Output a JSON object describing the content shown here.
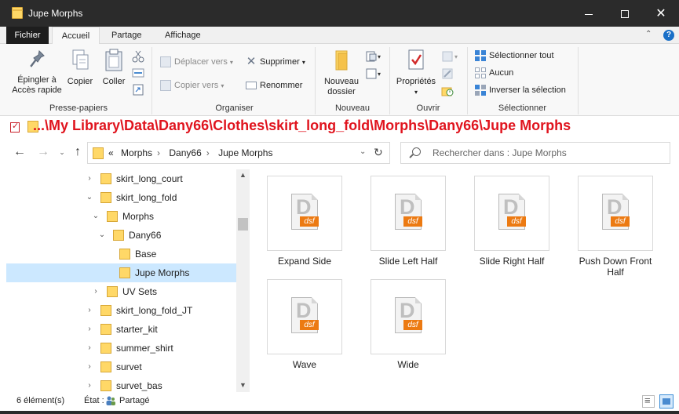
{
  "window": {
    "title": "Jupe Morphs",
    "controls": {
      "minimize": "minimize",
      "maximize": "maximize",
      "close": "close"
    }
  },
  "ribbon": {
    "tabs": {
      "file": "Fichier",
      "home": "Accueil",
      "share": "Partage",
      "view": "Affichage"
    },
    "clipboard": {
      "pin_line1": "Épingler à",
      "pin_line2": "Accès rapide",
      "copy": "Copier",
      "paste": "Coller",
      "label": "Presse-papiers"
    },
    "organize": {
      "move_to": "Déplacer vers",
      "copy_to": "Copier vers",
      "delete": "Supprimer",
      "rename": "Renommer",
      "label": "Organiser"
    },
    "new": {
      "new_folder_line1": "Nouveau",
      "new_folder_line2": "dossier",
      "label": "Nouveau"
    },
    "open": {
      "properties": "Propriétés",
      "label": "Ouvrir"
    },
    "select": {
      "select_all": "Sélectionner tout",
      "select_none": "Aucun",
      "invert": "Inverser la sélection",
      "label": "Sélectionner"
    }
  },
  "overlay_path": "...\\My Library\\Data\\Dany66\\Clothes\\skirt_long_fold\\Morphs\\Dany66\\Jupe Morphs",
  "address": {
    "overflow": "«",
    "crumbs": [
      "Morphs",
      "Dany66",
      "Jupe Morphs"
    ]
  },
  "search": {
    "placeholder": "Rechercher dans : Jupe Morphs"
  },
  "nav_tree": [
    {
      "label": "skirt_long_court",
      "expander": "›",
      "depth": 0,
      "selected": false
    },
    {
      "label": "skirt_long_fold",
      "expander": "⌄",
      "depth": 0,
      "selected": false
    },
    {
      "label": "Morphs",
      "expander": "⌄",
      "depth": 1,
      "selected": false
    },
    {
      "label": "Dany66",
      "expander": "⌄",
      "depth": 2,
      "selected": false
    },
    {
      "label": "Base",
      "expander": "",
      "depth": 3,
      "selected": false
    },
    {
      "label": "Jupe Morphs",
      "expander": "",
      "depth": 3,
      "selected": true
    },
    {
      "label": "UV Sets",
      "expander": "›",
      "depth": 1,
      "selected": false
    },
    {
      "label": "skirt_long_fold_JT",
      "expander": "›",
      "depth": 0,
      "selected": false
    },
    {
      "label": "starter_kit",
      "expander": "›",
      "depth": 0,
      "selected": false
    },
    {
      "label": "summer_shirt",
      "expander": "›",
      "depth": 0,
      "selected": false
    },
    {
      "label": "survet",
      "expander": "›",
      "depth": 0,
      "selected": false
    },
    {
      "label": "survet_bas",
      "expander": "›",
      "depth": 0,
      "selected": false
    }
  ],
  "files": [
    {
      "name": "Expand Side",
      "type_badge": "dsf",
      "letter": "D"
    },
    {
      "name": "Slide Left Half",
      "type_badge": "dsf",
      "letter": "D"
    },
    {
      "name": "Slide Right Half",
      "type_badge": "dsf",
      "letter": "D"
    },
    {
      "name": "Push Down Front Half",
      "type_badge": "dsf",
      "letter": "D"
    },
    {
      "name": "Wave",
      "type_badge": "dsf",
      "letter": "D"
    },
    {
      "name": "Wide",
      "type_badge": "dsf",
      "letter": "D"
    }
  ],
  "status": {
    "count": "6 élément(s)",
    "state_label": "État :",
    "shared": "Partagé"
  },
  "colors": {
    "titlebar": "#2b2b2b",
    "overlay_text": "#e0141e",
    "selection": "#cce8ff",
    "folder": "#ffd867",
    "dsf_badge": "#ec7a12"
  }
}
